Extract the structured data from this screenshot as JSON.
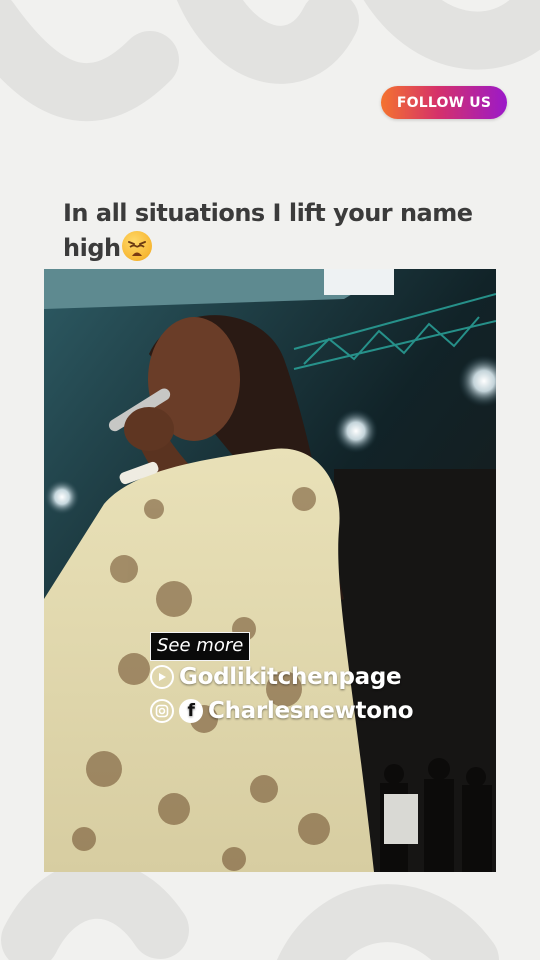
{
  "header": {
    "follow_label": "FOLLOW US"
  },
  "post": {
    "caption": "In all situations I lift your name high",
    "caption_emoji": "weary-face-emoji"
  },
  "video": {
    "see_more_label": "See more",
    "youtube_handle": "Godlikitchenpage",
    "facebook_handle": "Charlesnewtono"
  },
  "colors": {
    "background": "#f1f1ef",
    "follow_gradient_start": "#f4732f",
    "follow_gradient_end": "#9b19c9",
    "caption_text": "#3b3b3b"
  },
  "icons": {
    "youtube": "youtube-icon",
    "instagram": "instagram-icon",
    "facebook": "facebook-icon"
  }
}
